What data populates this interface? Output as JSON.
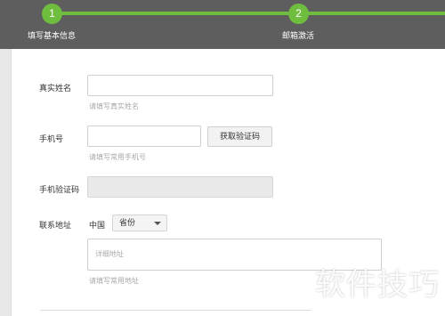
{
  "steps": [
    {
      "number": "1",
      "label": "填写基本信息"
    },
    {
      "number": "2",
      "label": "邮箱激活"
    }
  ],
  "form": {
    "real_name": {
      "label": "真实姓名",
      "value": "",
      "hint": "请填写真实姓名"
    },
    "phone": {
      "label": "手机号",
      "value": "",
      "hint": "请填写常用手机号",
      "button": "获取验证码"
    },
    "verify_code": {
      "label": "手机验证码",
      "value": ""
    },
    "address": {
      "label": "联系地址",
      "country": "中国",
      "province_selected": "省份",
      "detail_placeholder": "详细地址",
      "hint": "请填写常用地址"
    }
  },
  "watermark": "软件技巧",
  "colors": {
    "accent": "#6fbd3e",
    "header_bg": "#5e5e5e"
  }
}
